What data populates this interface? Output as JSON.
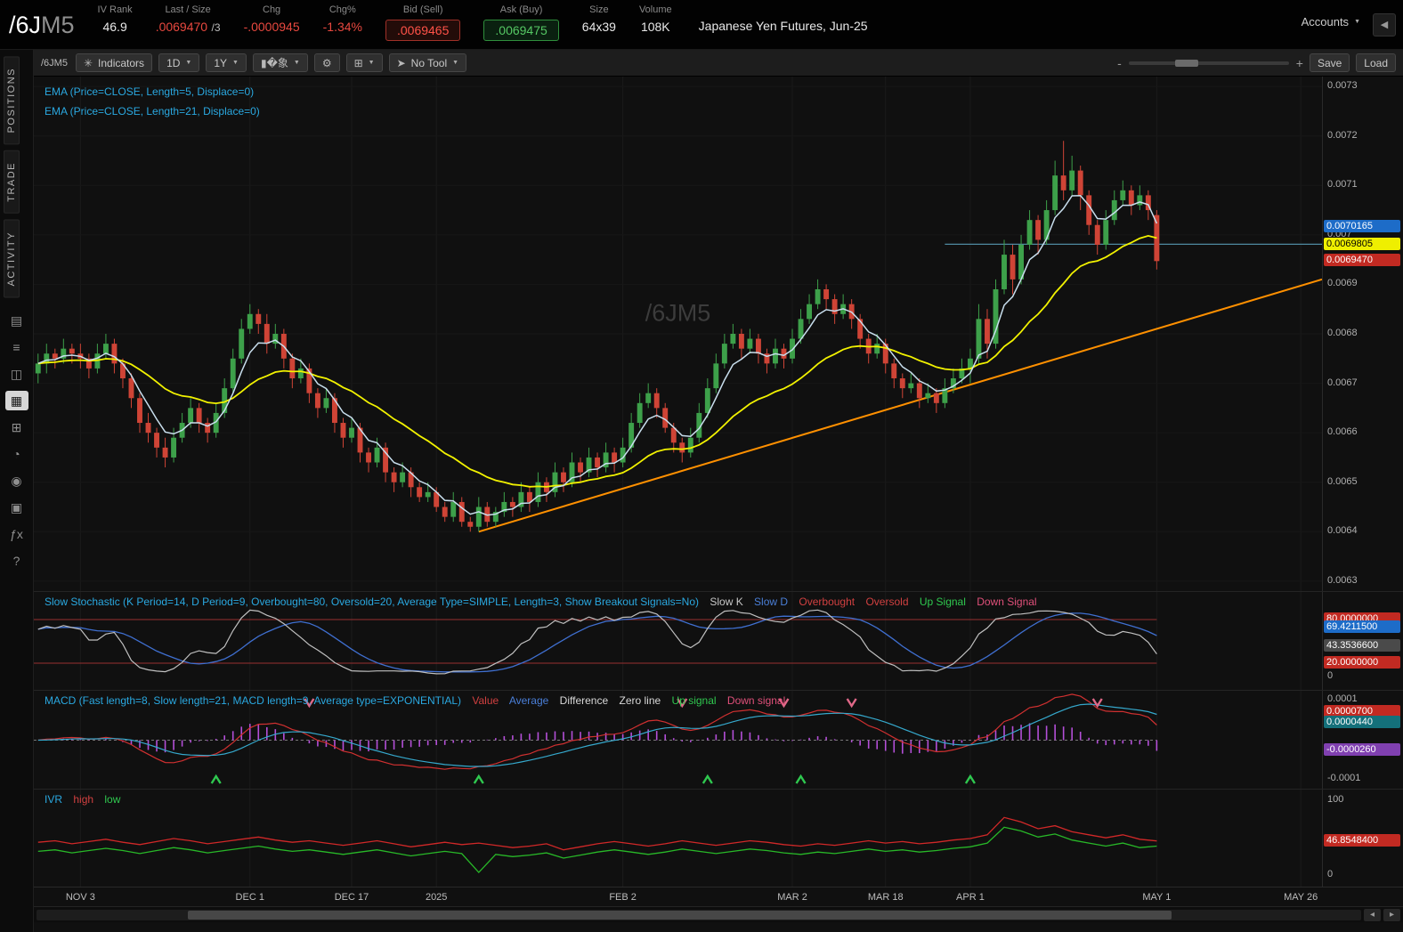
{
  "header": {
    "symbol_root": "/6J",
    "symbol_suffix": "M5",
    "iv_rank_label": "IV Rank",
    "iv_rank": "46.9",
    "last_label": "Last / Size",
    "last": ".0069470",
    "last_size": "/3",
    "chg_label": "Chg",
    "chg": "-.0000945",
    "chgpct_label": "Chg%",
    "chgpct": "-1.34%",
    "bid_label": "Bid (Sell)",
    "bid": ".0069465",
    "ask_label": "Ask (Buy)",
    "ask": ".0069475",
    "size_label": "Size",
    "size": "64x39",
    "volume_label": "Volume",
    "volume": "108K",
    "description": "Japanese Yen Futures, Jun-25",
    "accounts": "Accounts"
  },
  "sidebar": {
    "tabs": [
      {
        "label": "POSITIONS"
      },
      {
        "label": "TRADE"
      },
      {
        "label": "ACTIVITY"
      }
    ],
    "icons": [
      {
        "name": "quote-monitor-icon",
        "glyph": "▤"
      },
      {
        "name": "watchlist-icon",
        "glyph": "≡"
      },
      {
        "name": "flexible-grid-icon",
        "glyph": "◫"
      },
      {
        "name": "chart-icon",
        "glyph": "▦",
        "active": true
      },
      {
        "name": "grid-icon",
        "glyph": "⊞"
      },
      {
        "name": "clock-icon",
        "glyph": "◔"
      },
      {
        "name": "people-icon",
        "glyph": "◉"
      },
      {
        "name": "publish-icon",
        "glyph": "▣"
      },
      {
        "name": "fx-icon",
        "glyph": "ƒx"
      },
      {
        "name": "help-icon",
        "glyph": "?"
      }
    ]
  },
  "toolbar": {
    "symbol": "/6JM5",
    "indicators": "Indicators",
    "aggregation": "1D",
    "range": "1Y",
    "tool": "No Tool",
    "save": "Save",
    "load": "Load",
    "zoom_minus": "-",
    "zoom_plus": "+"
  },
  "panels": {
    "main": {
      "ema5_label": "EMA (Price=CLOSE, Length=5, Displace=0)",
      "ema21_label": "EMA (Price=CLOSE, Length=21, Displace=0)",
      "watermark": "/6JM5"
    },
    "stoch": {
      "title": "Slow Stochastic (K Period=14, D Period=9, Overbought=80, Oversold=20, Average Type=SIMPLE, Length=3, Show Breakout Signals=No)",
      "legend": [
        "Slow K",
        "Slow D",
        "Overbought",
        "Oversold",
        "Up Signal",
        "Down Signal"
      ]
    },
    "macd": {
      "title": "MACD (Fast length=8, Slow length=21, MACD length=9, Average type=EXPONENTIAL)",
      "legend": [
        "Value",
        "Average",
        "Difference",
        "Zero line",
        "Up signal",
        "Down signal"
      ]
    },
    "ivr": {
      "title": "IVR",
      "legend": [
        "high",
        "low"
      ]
    }
  },
  "colors": {
    "up": "#3da04a",
    "down": "#cf4436",
    "ema5": "#c9dfee",
    "ema21": "#f2f200",
    "trendline": "#ff9000",
    "hline": "#4e8aa0",
    "stoch_k": "#c0c0c0",
    "stoch_d": "#3f6fd0",
    "stoch_level": "#993030",
    "macd_value": "#d03030",
    "macd_average": "#35a8cc",
    "macd_hist": "#b44fd8",
    "up_signal": "#2fc84f",
    "down_signal": "#e06888",
    "ivr_high": "#d02828",
    "ivr_low": "#28b828"
  },
  "chart_data": {
    "type": "candlestick",
    "symbol": "/6JM5",
    "title": "Japanese Yen Futures, Jun-25",
    "price_scale": 0.0001,
    "note": "OHLC values are price x 10000 (e.g. 69.47 = 0.0069470), daily bars Oct 2024 - May 1 2025",
    "ohlc": [
      [
        67.2,
        67.6,
        67.0,
        67.4
      ],
      [
        67.4,
        67.8,
        67.2,
        67.6
      ],
      [
        67.6,
        67.7,
        67.3,
        67.5
      ],
      [
        67.5,
        67.9,
        67.4,
        67.7
      ],
      [
        67.7,
        67.8,
        67.4,
        67.6
      ],
      [
        67.6,
        67.8,
        67.3,
        67.5
      ],
      [
        67.5,
        67.6,
        67.1,
        67.3
      ],
      [
        67.3,
        67.8,
        67.2,
        67.6
      ],
      [
        67.6,
        68.0,
        67.5,
        67.8
      ],
      [
        67.8,
        67.9,
        67.2,
        67.4
      ],
      [
        67.4,
        67.5,
        66.9,
        67.1
      ],
      [
        67.1,
        67.2,
        66.5,
        66.7
      ],
      [
        66.7,
        66.8,
        66.0,
        66.2
      ],
      [
        66.2,
        66.4,
        65.8,
        66.0
      ],
      [
        66.0,
        66.1,
        65.5,
        65.7
      ],
      [
        65.7,
        65.9,
        65.3,
        65.5
      ],
      [
        65.5,
        66.1,
        65.4,
        65.9
      ],
      [
        65.9,
        66.4,
        65.8,
        66.2
      ],
      [
        66.2,
        66.7,
        66.1,
        66.5
      ],
      [
        66.5,
        66.6,
        66.0,
        66.2
      ],
      [
        66.2,
        66.3,
        65.8,
        66.0
      ],
      [
        66.0,
        66.6,
        65.9,
        66.4
      ],
      [
        66.4,
        67.1,
        66.3,
        66.9
      ],
      [
        66.9,
        67.7,
        66.8,
        67.5
      ],
      [
        67.5,
        68.3,
        67.4,
        68.1
      ],
      [
        68.1,
        68.6,
        68.0,
        68.4
      ],
      [
        68.4,
        68.5,
        68.0,
        68.2
      ],
      [
        68.2,
        68.4,
        67.6,
        67.8
      ],
      [
        67.8,
        68.2,
        67.7,
        68.0
      ],
      [
        68.0,
        68.1,
        67.3,
        67.5
      ],
      [
        67.5,
        67.6,
        66.9,
        67.1
      ],
      [
        67.1,
        67.5,
        67.0,
        67.3
      ],
      [
        67.3,
        67.4,
        66.6,
        66.8
      ],
      [
        66.8,
        66.9,
        66.3,
        66.5
      ],
      [
        66.5,
        66.9,
        66.4,
        66.7
      ],
      [
        66.7,
        66.8,
        66.0,
        66.2
      ],
      [
        66.2,
        66.3,
        65.7,
        65.9
      ],
      [
        65.9,
        66.3,
        65.8,
        66.1
      ],
      [
        66.1,
        66.2,
        65.4,
        65.6
      ],
      [
        65.6,
        65.7,
        65.2,
        65.4
      ],
      [
        65.4,
        65.9,
        65.3,
        65.7
      ],
      [
        65.7,
        65.8,
        65.0,
        65.2
      ],
      [
        65.2,
        65.3,
        64.8,
        65.0
      ],
      [
        65.0,
        65.4,
        64.9,
        65.2
      ],
      [
        65.2,
        65.3,
        64.7,
        64.9
      ],
      [
        64.9,
        65.0,
        64.6,
        64.7
      ],
      [
        64.7,
        65.0,
        64.6,
        64.8
      ],
      [
        64.8,
        64.9,
        64.4,
        64.5
      ],
      [
        64.5,
        64.6,
        64.2,
        64.3
      ],
      [
        64.3,
        64.8,
        64.2,
        64.6
      ],
      [
        64.6,
        64.7,
        64.1,
        64.2
      ],
      [
        64.2,
        64.3,
        64.0,
        64.1
      ],
      [
        64.1,
        64.7,
        64.0,
        64.5
      ],
      [
        64.5,
        64.6,
        64.1,
        64.2
      ],
      [
        64.2,
        64.5,
        64.1,
        64.4
      ],
      [
        64.4,
        64.8,
        64.3,
        64.6
      ],
      [
        64.6,
        64.7,
        64.3,
        64.5
      ],
      [
        64.5,
        65.0,
        64.4,
        64.8
      ],
      [
        64.8,
        64.9,
        64.4,
        64.6
      ],
      [
        64.6,
        65.2,
        64.5,
        65.0
      ],
      [
        65.0,
        65.1,
        64.6,
        64.8
      ],
      [
        64.8,
        65.4,
        64.7,
        65.2
      ],
      [
        65.2,
        65.3,
        64.8,
        65.0
      ],
      [
        65.0,
        65.6,
        64.9,
        65.4
      ],
      [
        65.4,
        65.5,
        65.0,
        65.2
      ],
      [
        65.2,
        65.7,
        65.1,
        65.5
      ],
      [
        65.5,
        65.6,
        65.1,
        65.3
      ],
      [
        65.3,
        65.8,
        65.2,
        65.6
      ],
      [
        65.6,
        65.7,
        65.2,
        65.4
      ],
      [
        65.4,
        65.9,
        65.3,
        65.7
      ],
      [
        65.7,
        66.4,
        65.6,
        66.2
      ],
      [
        66.2,
        66.8,
        66.1,
        66.6
      ],
      [
        66.6,
        67.0,
        66.5,
        66.8
      ],
      [
        66.8,
        66.9,
        66.3,
        66.5
      ],
      [
        66.5,
        66.6,
        66.0,
        66.1
      ],
      [
        66.1,
        66.2,
        65.6,
        65.8
      ],
      [
        65.8,
        65.9,
        65.4,
        65.6
      ],
      [
        65.6,
        66.1,
        65.5,
        65.9
      ],
      [
        65.9,
        66.6,
        65.8,
        66.4
      ],
      [
        66.4,
        67.1,
        66.3,
        66.9
      ],
      [
        66.9,
        67.6,
        66.8,
        67.4
      ],
      [
        67.4,
        68.0,
        67.3,
        67.8
      ],
      [
        67.8,
        68.2,
        67.7,
        68.0
      ],
      [
        68.0,
        68.1,
        67.5,
        67.7
      ],
      [
        67.7,
        68.1,
        67.6,
        67.9
      ],
      [
        67.9,
        68.0,
        67.4,
        67.6
      ],
      [
        67.6,
        67.7,
        67.2,
        67.4
      ],
      [
        67.4,
        67.9,
        67.3,
        67.7
      ],
      [
        67.7,
        67.8,
        67.3,
        67.5
      ],
      [
        67.5,
        68.1,
        67.4,
        67.9
      ],
      [
        67.9,
        68.5,
        67.8,
        68.3
      ],
      [
        68.3,
        68.8,
        68.2,
        68.6
      ],
      [
        68.6,
        69.1,
        68.5,
        68.9
      ],
      [
        68.9,
        69.0,
        68.5,
        68.7
      ],
      [
        68.7,
        68.8,
        68.2,
        68.4
      ],
      [
        68.4,
        68.8,
        68.3,
        68.6
      ],
      [
        68.6,
        68.7,
        68.1,
        68.3
      ],
      [
        68.3,
        68.4,
        67.7,
        67.9
      ],
      [
        67.9,
        68.0,
        67.4,
        67.6
      ],
      [
        67.6,
        68.0,
        67.5,
        67.8
      ],
      [
        67.8,
        67.9,
        67.2,
        67.4
      ],
      [
        67.4,
        67.5,
        66.9,
        67.1
      ],
      [
        67.1,
        67.2,
        66.7,
        66.9
      ],
      [
        66.9,
        67.2,
        66.8,
        67.0
      ],
      [
        67.0,
        67.1,
        66.5,
        66.7
      ],
      [
        66.7,
        67.0,
        66.6,
        66.8
      ],
      [
        66.8,
        66.9,
        66.4,
        66.6
      ],
      [
        66.6,
        67.1,
        66.5,
        66.9
      ],
      [
        66.9,
        67.3,
        66.8,
        67.1
      ],
      [
        67.1,
        67.5,
        67.0,
        67.3
      ],
      [
        67.3,
        67.7,
        67.0,
        67.5
      ],
      [
        67.5,
        68.6,
        67.4,
        68.3
      ],
      [
        68.3,
        68.5,
        67.5,
        67.8
      ],
      [
        67.8,
        69.1,
        67.7,
        68.9
      ],
      [
        68.9,
        69.9,
        68.8,
        69.6
      ],
      [
        69.6,
        69.8,
        68.8,
        69.1
      ],
      [
        69.1,
        70.0,
        69.0,
        69.8
      ],
      [
        69.8,
        70.5,
        69.7,
        70.3
      ],
      [
        70.3,
        70.4,
        69.6,
        69.9
      ],
      [
        69.9,
        70.7,
        69.8,
        70.5
      ],
      [
        70.5,
        71.5,
        70.4,
        71.2
      ],
      [
        71.2,
        71.9,
        70.7,
        70.9
      ],
      [
        70.9,
        71.6,
        70.8,
        71.3
      ],
      [
        71.3,
        71.4,
        70.5,
        70.8
      ],
      [
        70.8,
        70.9,
        70.0,
        70.2
      ],
      [
        70.2,
        70.3,
        69.6,
        69.8
      ],
      [
        69.8,
        70.5,
        69.7,
        70.3
      ],
      [
        70.3,
        70.9,
        70.2,
        70.7
      ],
      [
        70.7,
        71.1,
        70.6,
        70.9
      ],
      [
        70.9,
        71.0,
        70.4,
        70.6
      ],
      [
        70.6,
        71.0,
        70.5,
        70.8
      ],
      [
        70.8,
        70.9,
        70.3,
        70.5
      ],
      [
        70.4,
        70.5,
        69.3,
        69.47
      ]
    ],
    "price_axis": {
      "max": 73.2,
      "min": 62.8,
      "ticks": [
        "0.0073",
        "0.0072",
        "0.0071",
        "0.007",
        "0.0069",
        "0.0068",
        "0.0067",
        "0.0066",
        "0.0065",
        "0.0064",
        "0.0063"
      ]
    },
    "bubbles": [
      {
        "text": "0.0070165",
        "value": 70.165,
        "type": "blue"
      },
      {
        "text": "0.0069805",
        "value": 69.805,
        "type": "yellow"
      },
      {
        "text": "0.0069470",
        "value": 69.47,
        "type": "red"
      }
    ],
    "trendline": {
      "from_index": 52,
      "from_price": 64.0,
      "to_price": 69.1
    },
    "hline": {
      "from_index": 107,
      "price": 69.81
    },
    "time_axis": {
      "slots": 152,
      "labels": [
        {
          "text": "NOV 3",
          "slot": 5
        },
        {
          "text": "DEC 1",
          "slot": 25
        },
        {
          "text": "DEC 17",
          "slot": 37
        },
        {
          "text": "2025",
          "slot": 47
        },
        {
          "text": "FEB 2",
          "slot": 69
        },
        {
          "text": "MAR 2",
          "slot": 89
        },
        {
          "text": "MAR 18",
          "slot": 100
        },
        {
          "text": "APR 1",
          "slot": 110
        },
        {
          "text": "MAY 1",
          "slot": 132
        },
        {
          "text": "MAY 26",
          "slot": 149
        }
      ]
    },
    "stoch_axis": {
      "labels": [
        {
          "text": "80.0000000",
          "value": 80,
          "type": "red"
        },
        {
          "text": "69.4211500",
          "value": 69.42115,
          "type": "blue"
        },
        {
          "text": "43.3536600",
          "value": 43.35366,
          "type": "gray"
        },
        {
          "text": "20.0000000",
          "value": 20,
          "type": "red"
        },
        {
          "text": "0",
          "value": 0,
          "type": "plain"
        }
      ]
    },
    "macd_axis": {
      "labels": [
        {
          "text": "0.0001",
          "value": 1.0,
          "type": "plain"
        },
        {
          "text": "0.0000700",
          "value": 0.7,
          "type": "red"
        },
        {
          "text": "0.0000440",
          "value": 0.44,
          "type": "teal"
        },
        {
          "text": "-0.0000260",
          "value": -0.26,
          "type": "purple"
        },
        {
          "text": "-0.0001",
          "value": -1.0,
          "type": "plain"
        }
      ]
    },
    "ivr_axis": {
      "labels": [
        {
          "text": "100",
          "value": 100,
          "type": "plain"
        },
        {
          "text": "46.8548400",
          "value": 46.85484,
          "type": "red"
        },
        {
          "text": "0",
          "value": 0,
          "type": "plain"
        }
      ]
    },
    "ivr_high": [
      45,
      47,
      43,
      46,
      49,
      45,
      42,
      46,
      50,
      47,
      43,
      46,
      49,
      52,
      48,
      45,
      47,
      44,
      41,
      44,
      47,
      43,
      39,
      42,
      45,
      42,
      44,
      41,
      38,
      40,
      43,
      35,
      39,
      43,
      46,
      43,
      40,
      43,
      47,
      44,
      41,
      44,
      47,
      45,
      42,
      40,
      43,
      41,
      44,
      47,
      44,
      46,
      43,
      45,
      48,
      50,
      55,
      78,
      72,
      63,
      67,
      59,
      55,
      51,
      55,
      49,
      46.85
    ],
    "ivr_low": [
      33,
      35,
      31,
      34,
      37,
      34,
      30,
      34,
      38,
      35,
      31,
      34,
      37,
      40,
      36,
      33,
      35,
      32,
      29,
      32,
      35,
      31,
      27,
      30,
      33,
      30,
      5,
      29,
      26,
      28,
      31,
      24,
      28,
      32,
      35,
      32,
      29,
      32,
      36,
      33,
      30,
      33,
      36,
      34,
      31,
      29,
      32,
      30,
      33,
      36,
      33,
      35,
      32,
      34,
      37,
      39,
      44,
      65,
      60,
      52,
      56,
      48,
      44,
      40,
      44,
      38,
      40
    ]
  }
}
